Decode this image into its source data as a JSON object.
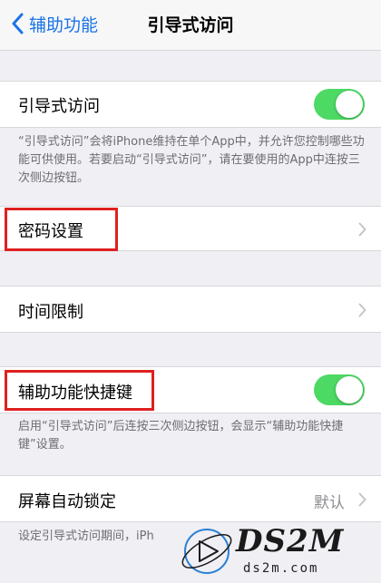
{
  "nav": {
    "back_label": "辅助功能",
    "title": "引导式访问"
  },
  "guided_access": {
    "label": "引导式访问",
    "toggle_on": true,
    "footnote": "“引导式访问”会将iPhone维持在单个App中，并允许您控制哪些功能可供使用。若要启动“引导式访问”，请在要使用的App中连按三次侧边按钮。"
  },
  "passcode": {
    "label": "密码设置"
  },
  "time_limits": {
    "label": "时间限制"
  },
  "accessibility_shortcut": {
    "label": "辅助功能快捷键",
    "toggle_on": true,
    "footnote": "启用“引导式访问”后连按三次侧边按钮，会显示“辅助功能快捷键”设置。"
  },
  "auto_lock": {
    "label": "屏幕自动锁定",
    "value": "默认",
    "footnote": "设定引导式访问期间，iPh"
  },
  "watermark": {
    "brand": "DS2M",
    "domain": "ds2m.com"
  },
  "colors": {
    "accent": "#1a73e8",
    "toggle_on": "#4cd964",
    "highlight": "#e02020",
    "background": "#efeff4"
  }
}
